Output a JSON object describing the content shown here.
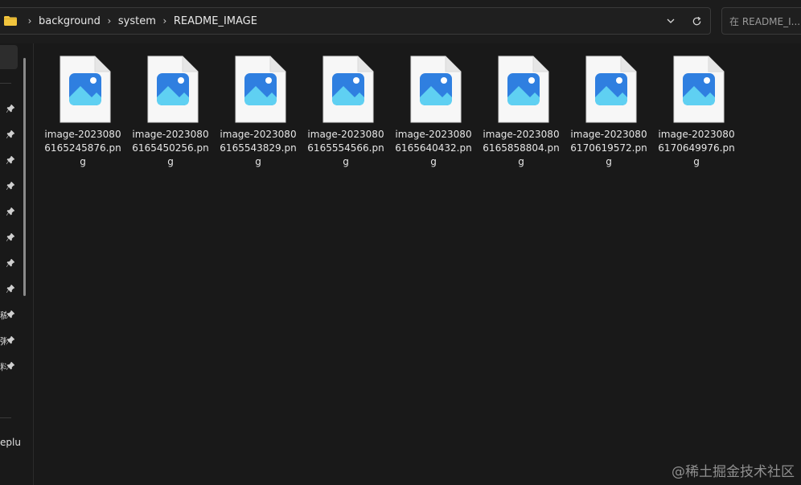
{
  "addressbar": {
    "breadcrumbs": [
      "background",
      "system",
      "README_IMAGE"
    ]
  },
  "search": {
    "placeholder": "在 README_I..."
  },
  "navpane": {
    "truncated_labels": [
      "稿",
      "粥",
      "料"
    ],
    "bottom_label": "eplu"
  },
  "files": [
    {
      "name": "image-20230806165245876.png"
    },
    {
      "name": "image-20230806165450256.png"
    },
    {
      "name": "image-20230806165543829.png"
    },
    {
      "name": "image-20230806165554566.png"
    },
    {
      "name": "image-20230806165640432.png"
    },
    {
      "name": "image-20230806165858804.png"
    },
    {
      "name": "image-20230806170619572.png"
    },
    {
      "name": "image-20230806170649976.png"
    }
  ],
  "watermark": {
    "text": "@稀土掘金技术社区"
  },
  "colors": {
    "background": "#191919",
    "folder": "#f2c53d",
    "image_icon_blue": "#2f7fe0",
    "image_icon_light": "#5fd0f2"
  }
}
